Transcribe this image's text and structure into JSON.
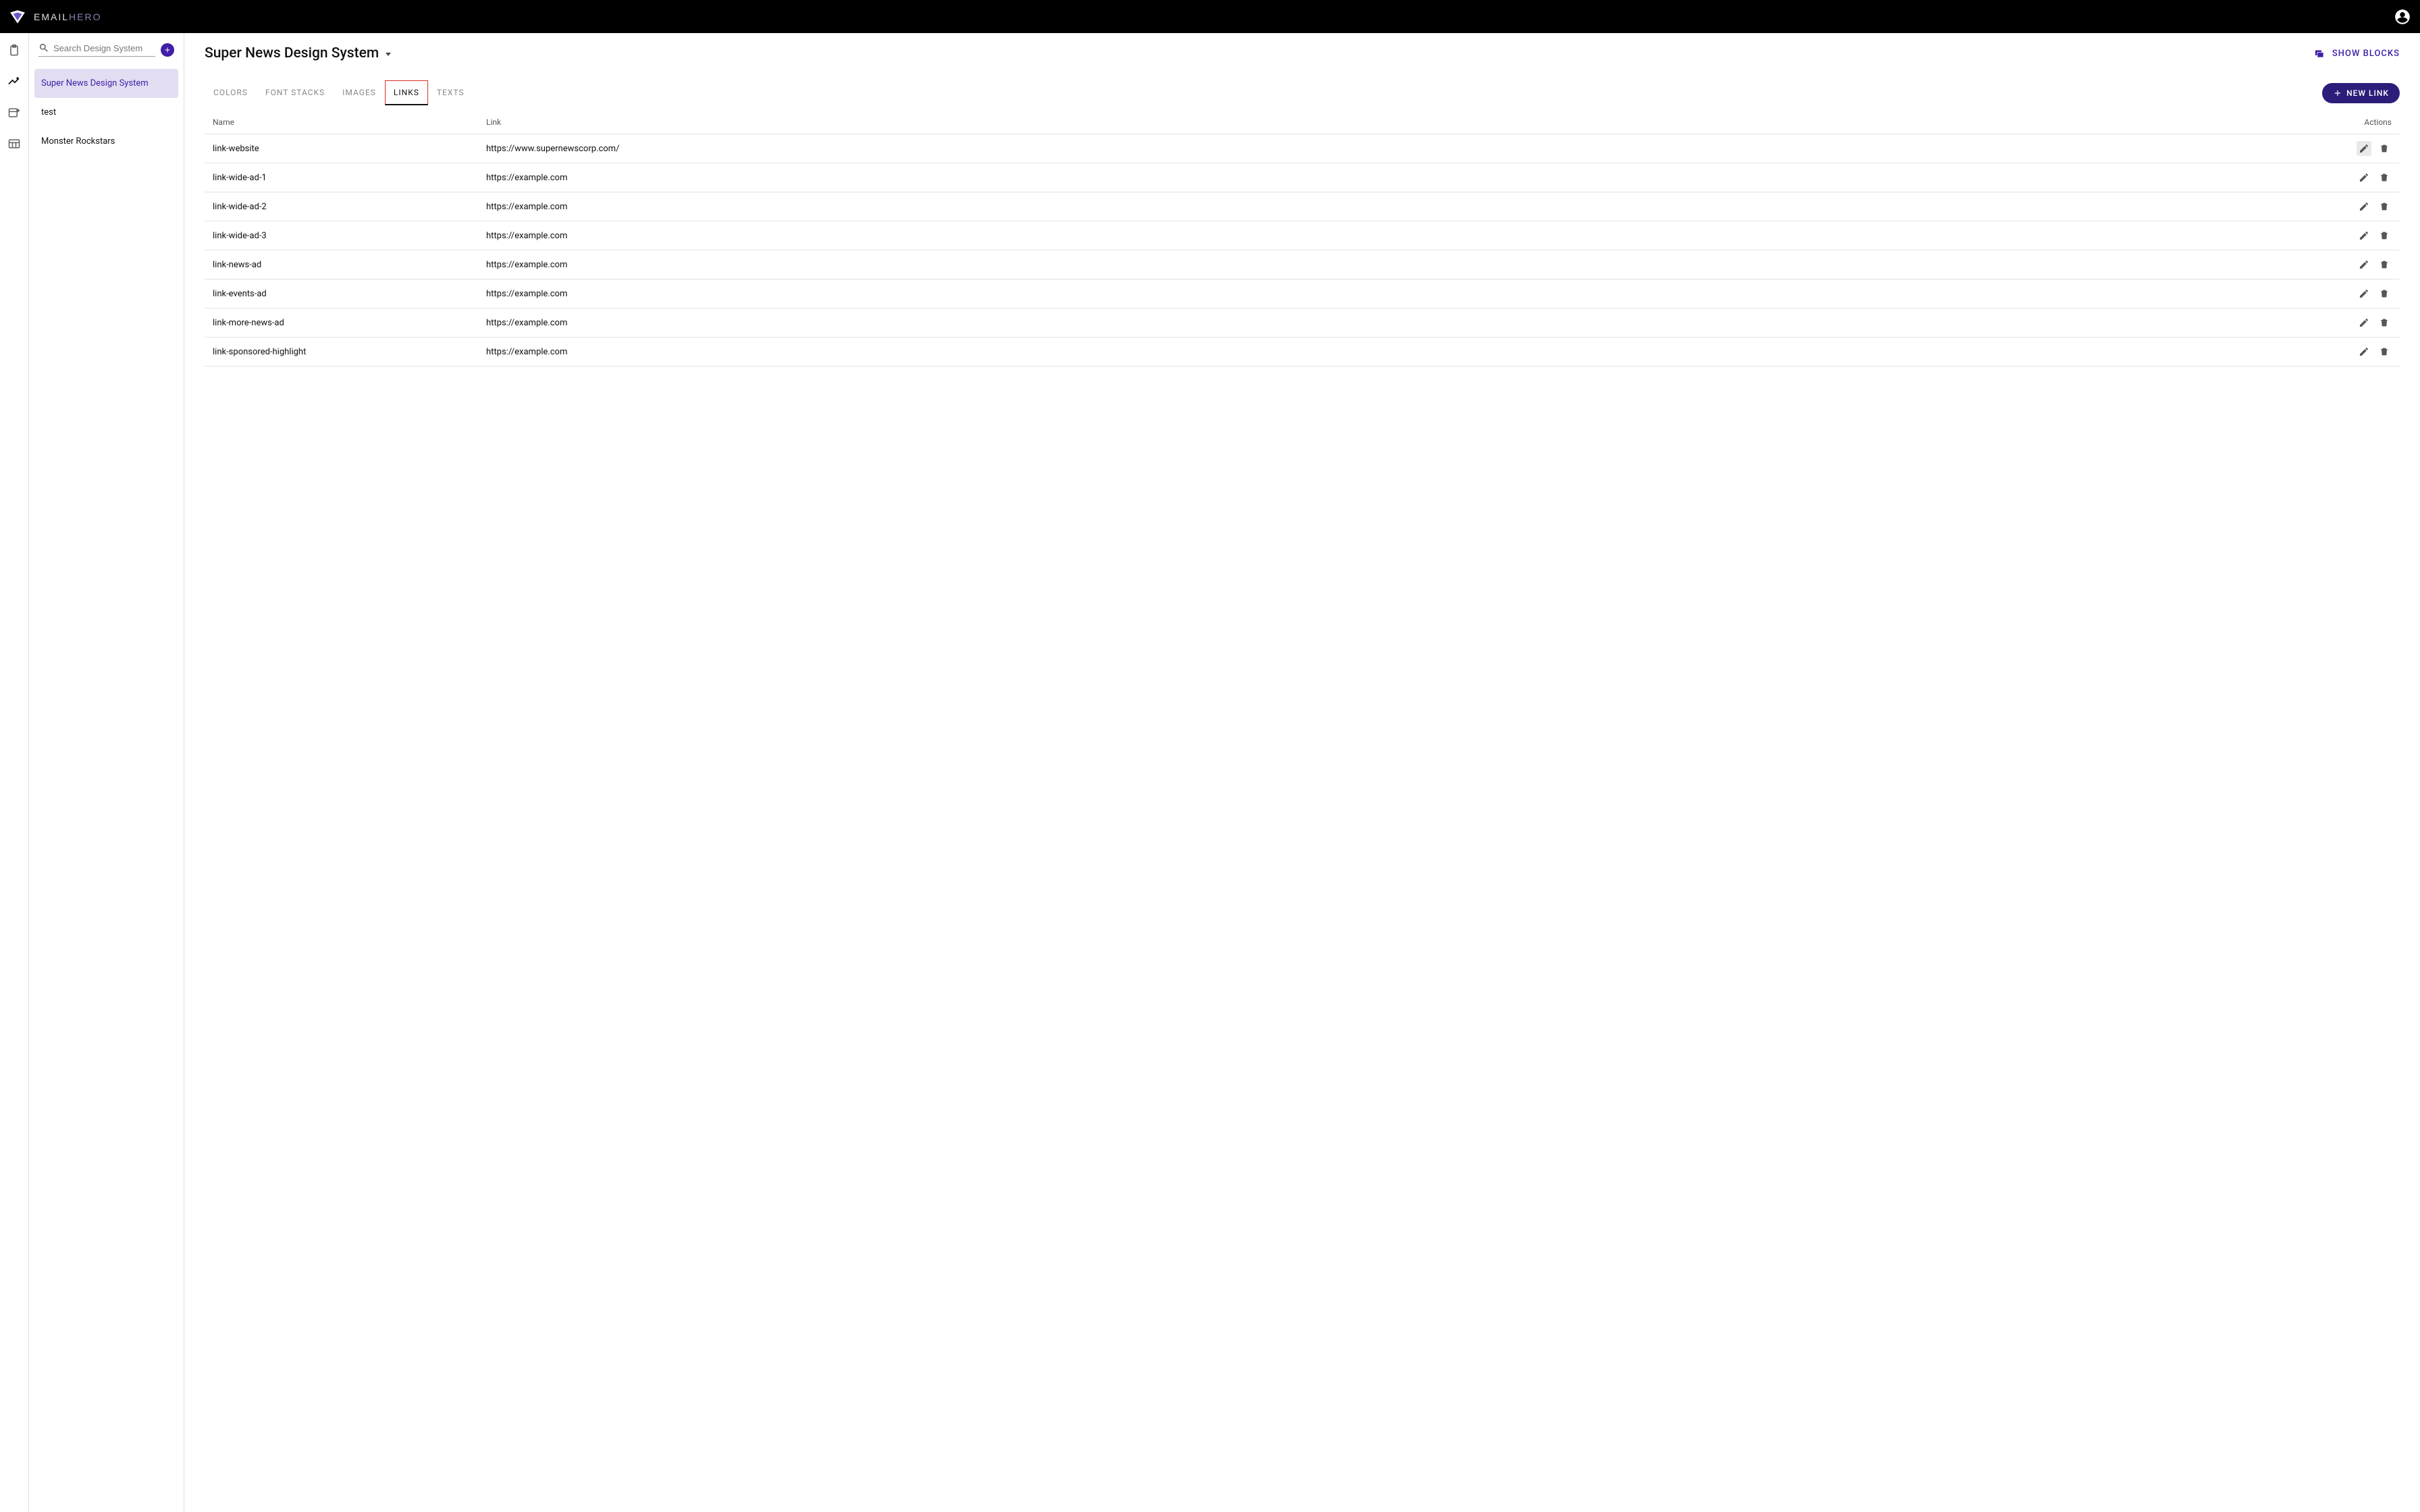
{
  "brand": {
    "part1": "EMAIL",
    "part2": "HERO"
  },
  "search": {
    "placeholder": "Search Design System"
  },
  "sidebar": {
    "items": [
      {
        "label": "Super News Design System",
        "selected": true
      },
      {
        "label": "test",
        "selected": false
      },
      {
        "label": "Monster Rockstars",
        "selected": false
      }
    ]
  },
  "header": {
    "title": "Super News Design System",
    "show_blocks_label": "SHOW BLOCKS",
    "new_link_label": "NEW LINK"
  },
  "tabs": [
    {
      "label": "COLORS",
      "active": false
    },
    {
      "label": "FONT STACKS",
      "active": false
    },
    {
      "label": "IMAGES",
      "active": false
    },
    {
      "label": "LINKS",
      "active": true
    },
    {
      "label": "TEXTS",
      "active": false
    }
  ],
  "table": {
    "headers": {
      "name": "Name",
      "link": "Link",
      "actions": "Actions"
    },
    "rows": [
      {
        "name": "link-website",
        "link": "https://www.supernewscorp.com/",
        "edit_hover": true
      },
      {
        "name": "link-wide-ad-1",
        "link": "https://example.com",
        "edit_hover": false
      },
      {
        "name": "link-wide-ad-2",
        "link": "https://example.com",
        "edit_hover": false
      },
      {
        "name": "link-wide-ad-3",
        "link": "https://example.com",
        "edit_hover": false
      },
      {
        "name": "link-news-ad",
        "link": "https://example.com",
        "edit_hover": false
      },
      {
        "name": "link-events-ad",
        "link": "https://example.com",
        "edit_hover": false
      },
      {
        "name": "link-more-news-ad",
        "link": "https://example.com",
        "edit_hover": false
      },
      {
        "name": "link-sponsored-highlight",
        "link": "https://example.com",
        "edit_hover": false
      }
    ]
  }
}
